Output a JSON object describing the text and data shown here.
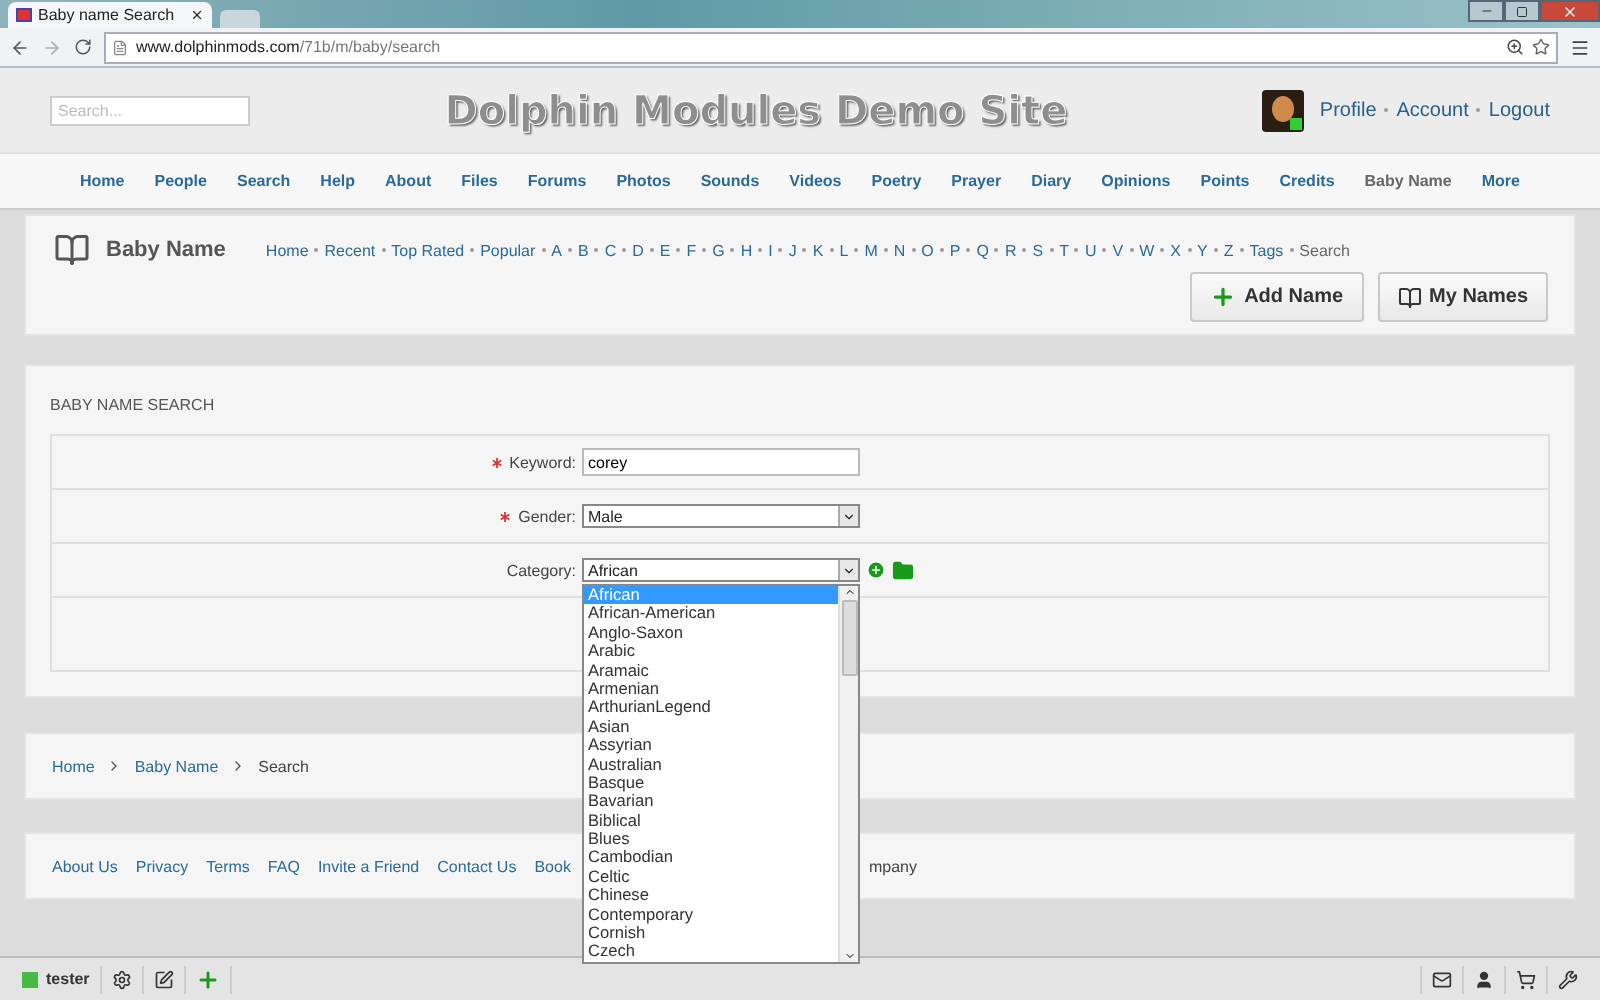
{
  "browser": {
    "tab_title": "Baby name Search",
    "url_host": "www.dolphinmods.com",
    "url_path": "/71b/m/baby/search"
  },
  "header": {
    "search_placeholder": "Search...",
    "title": "Dolphin Modules Demo Site",
    "user_links": [
      "Profile",
      "Account",
      "Logout"
    ]
  },
  "nav": [
    {
      "label": "Home",
      "selected": false
    },
    {
      "label": "People",
      "selected": false
    },
    {
      "label": "Search",
      "selected": false
    },
    {
      "label": "Help",
      "selected": false
    },
    {
      "label": "About",
      "selected": false
    },
    {
      "label": "Files",
      "selected": false
    },
    {
      "label": "Forums",
      "selected": false
    },
    {
      "label": "Photos",
      "selected": false
    },
    {
      "label": "Sounds",
      "selected": false
    },
    {
      "label": "Videos",
      "selected": false
    },
    {
      "label": "Poetry",
      "selected": false
    },
    {
      "label": "Prayer",
      "selected": false
    },
    {
      "label": "Diary",
      "selected": false
    },
    {
      "label": "Opinions",
      "selected": false
    },
    {
      "label": "Points",
      "selected": false
    },
    {
      "label": "Credits",
      "selected": false
    },
    {
      "label": "Baby Name",
      "selected": true
    },
    {
      "label": "More",
      "selected": false
    }
  ],
  "module": {
    "title": "Baby Name",
    "links": [
      {
        "label": "Home",
        "selected": false
      },
      {
        "label": "Recent",
        "selected": false
      },
      {
        "label": "Top Rated",
        "selected": false
      },
      {
        "label": "Popular",
        "selected": false
      },
      {
        "label": "A",
        "selected": false
      },
      {
        "label": "B",
        "selected": false
      },
      {
        "label": "C",
        "selected": false
      },
      {
        "label": "D",
        "selected": false
      },
      {
        "label": "E",
        "selected": false
      },
      {
        "label": "F",
        "selected": false
      },
      {
        "label": "G",
        "selected": false
      },
      {
        "label": "H",
        "selected": false
      },
      {
        "label": "I",
        "selected": false
      },
      {
        "label": "J",
        "selected": false
      },
      {
        "label": "K",
        "selected": false
      },
      {
        "label": "L",
        "selected": false
      },
      {
        "label": "M",
        "selected": false
      },
      {
        "label": "N",
        "selected": false
      },
      {
        "label": "O",
        "selected": false
      },
      {
        "label": "P",
        "selected": false
      },
      {
        "label": "Q",
        "selected": false
      },
      {
        "label": "R",
        "selected": false
      },
      {
        "label": "S",
        "selected": false
      },
      {
        "label": "T",
        "selected": false
      },
      {
        "label": "U",
        "selected": false
      },
      {
        "label": "V",
        "selected": false
      },
      {
        "label": "W",
        "selected": false
      },
      {
        "label": "X",
        "selected": false
      },
      {
        "label": "Y",
        "selected": false
      },
      {
        "label": "Z",
        "selected": false
      },
      {
        "label": "Tags",
        "selected": false
      },
      {
        "label": "Search",
        "selected": true
      }
    ],
    "buttons": [
      {
        "label": "Add Name",
        "kind": "add"
      },
      {
        "label": "My Names",
        "kind": "book"
      }
    ]
  },
  "form": {
    "heading": "BABY NAME SEARCH",
    "fields": [
      {
        "label": "Keyword:",
        "required": true,
        "kind": "text",
        "value": "corey"
      },
      {
        "label": "Gender:",
        "required": true,
        "kind": "select",
        "value": "Male"
      },
      {
        "label": "Category:",
        "required": false,
        "kind": "category",
        "value": "African"
      }
    ],
    "category_options": [
      {
        "label": "African",
        "selected": true
      },
      {
        "label": "African-American",
        "selected": false
      },
      {
        "label": "Anglo-Saxon",
        "selected": false
      },
      {
        "label": "Arabic",
        "selected": false
      },
      {
        "label": "Aramaic",
        "selected": false
      },
      {
        "label": "Armenian",
        "selected": false
      },
      {
        "label": "ArthurianLegend",
        "selected": false
      },
      {
        "label": "Asian",
        "selected": false
      },
      {
        "label": "Assyrian",
        "selected": false
      },
      {
        "label": "Australian",
        "selected": false
      },
      {
        "label": "Basque",
        "selected": false
      },
      {
        "label": "Bavarian",
        "selected": false
      },
      {
        "label": "Biblical",
        "selected": false
      },
      {
        "label": "Blues",
        "selected": false
      },
      {
        "label": "Cambodian",
        "selected": false
      },
      {
        "label": "Celtic",
        "selected": false
      },
      {
        "label": "Chinese",
        "selected": false
      },
      {
        "label": "Contemporary",
        "selected": false
      },
      {
        "label": "Cornish",
        "selected": false
      },
      {
        "label": "Czech",
        "selected": false
      }
    ]
  },
  "breadcrumb": [
    "Home",
    "Baby Name",
    "Search"
  ],
  "footer": {
    "links": [
      "About Us",
      "Privacy",
      "Terms",
      "FAQ",
      "Invite a Friend",
      "Contact Us",
      "Book"
    ],
    "trailing": "mpany"
  },
  "bottom_bar": {
    "user": "tester"
  }
}
